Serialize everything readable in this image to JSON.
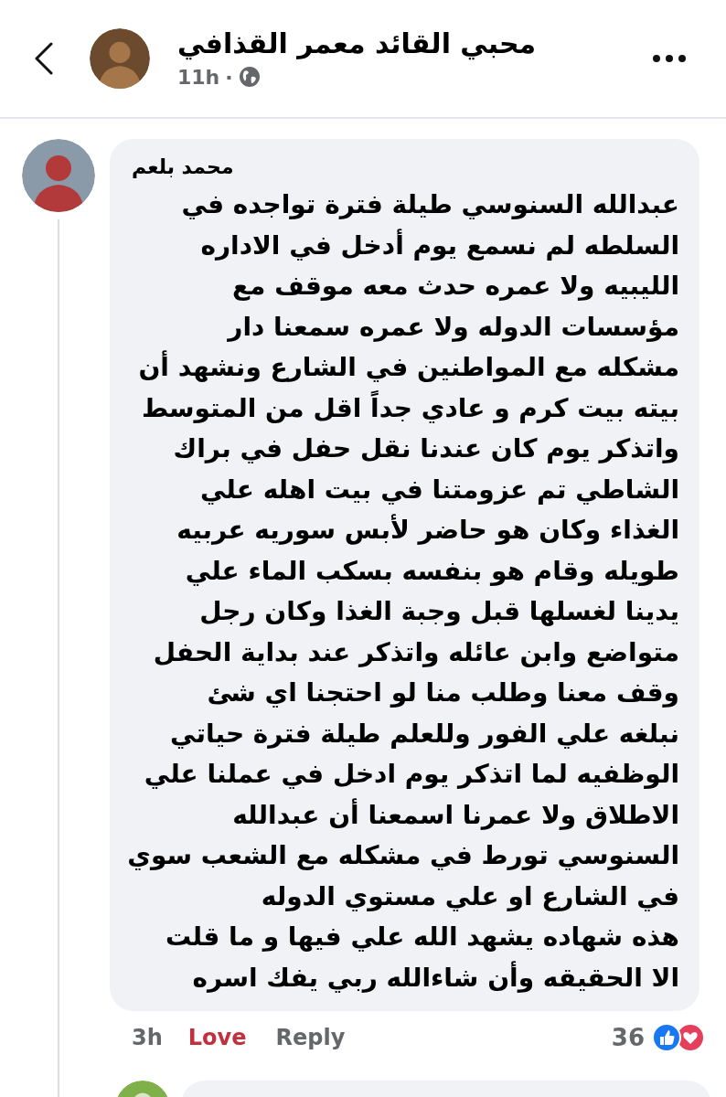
{
  "header": {
    "title": "محبي القائد معمر القذافي",
    "time": "11h",
    "separator": "·"
  },
  "comment": {
    "author": "محمد بلعم",
    "lines": [
      "عبدالله السنوسي طيلة فترة تواجده في",
      "السلطه لم نسمع يوم أدخل في الاداره",
      "الليبيه ولا عمره حدث معه موقف مع",
      "مؤسسات الدوله ولا عمره سمعنا دار",
      "مشكله مع المواطنين في الشارع ونشهد أن",
      "بيته بيت كرم و عادي جداً اقل من المتوسط",
      "واتذكر يوم كان عندنا نقل حفل في براك",
      "الشاطي تم عزومتنا في بيت اهله علي",
      "الغذاء وكان هو حاضر لأبس سوريه عربيه",
      "طويله وقام هو بنفسه بسكب الماء علي",
      "يدينا لغسلها قبل وجبة الغذا وكان رجل",
      "متواضع وابن عائله واتذكر عند بداية الحفل",
      "وقف معنا وطلب منا لو احتجنا اي شئ",
      "نبلغه علي الفور وللعلم طيلة فترة حياتي",
      "الوظفيه لما اتذكر يوم ادخل في عملنا علي",
      "الاطلاق ولا عمرنا اسمعنا أن عبدالله",
      "السنوسي تورط في مشكله مع الشعب سوي",
      "في الشارع او علي مستوي الدوله",
      "هذه شهاده يشهد الله علي فيها و ما قلت",
      "الا الحقيقه وأن شاءالله ربي يفك اسره"
    ],
    "time": "3h",
    "reaction": {
      "label": "Love",
      "selected": true
    },
    "reply": "Reply",
    "reaction_count": "36"
  }
}
